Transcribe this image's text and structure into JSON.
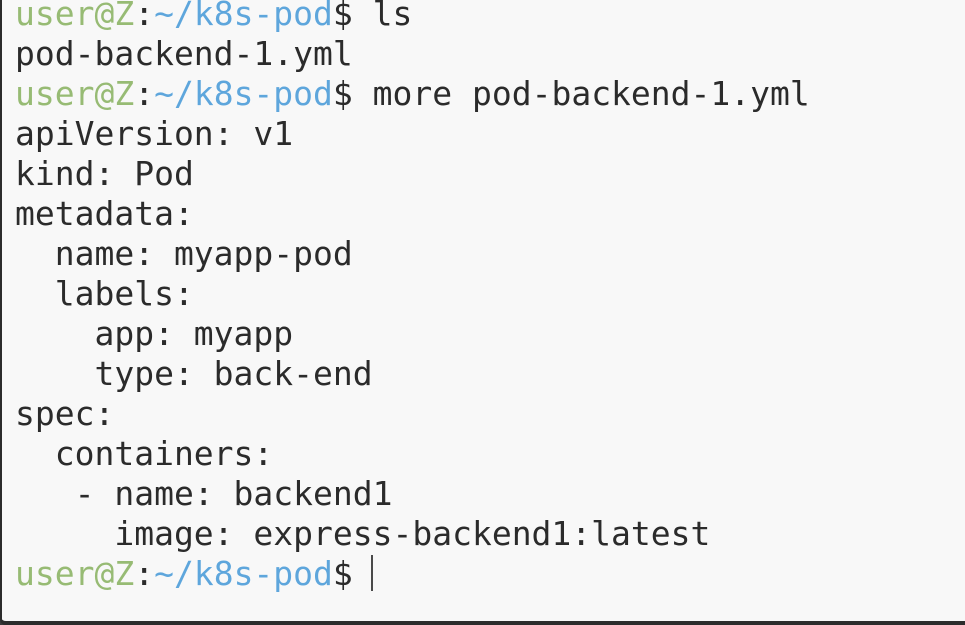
{
  "prompt": {
    "user_host": "user@Z",
    "separator": ":",
    "path": "~/k8s-pod",
    "symbol": "$"
  },
  "lines": [
    {
      "type": "command",
      "text": " ls"
    },
    {
      "type": "output",
      "text": "pod-backend-1.yml"
    },
    {
      "type": "command",
      "text": " more pod-backend-1.yml"
    },
    {
      "type": "output",
      "text": "apiVersion: v1"
    },
    {
      "type": "output",
      "text": "kind: Pod"
    },
    {
      "type": "output",
      "text": "metadata:"
    },
    {
      "type": "output",
      "text": "  name: myapp-pod"
    },
    {
      "type": "output",
      "text": "  labels:"
    },
    {
      "type": "output",
      "text": "    app: myapp"
    },
    {
      "type": "output",
      "text": "    type: back-end"
    },
    {
      "type": "output",
      "text": "spec:"
    },
    {
      "type": "output",
      "text": "  containers:"
    },
    {
      "type": "output",
      "text": "   - name: backend1"
    },
    {
      "type": "output",
      "text": "     image: express-backend1:latest"
    },
    {
      "type": "input",
      "text": ""
    }
  ],
  "colors": {
    "background": "#f8f8f8",
    "text": "#2b2b2b",
    "prompt_user": "#97bb74",
    "prompt_path": "#5ea6dc"
  }
}
